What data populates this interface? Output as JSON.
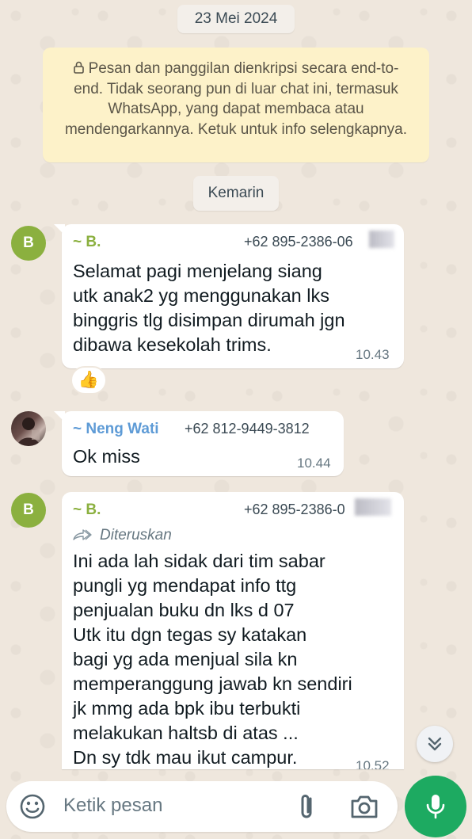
{
  "date_chip": "23 Mei 2024",
  "encryption_notice": "Pesan dan panggilan dienkripsi secara end-to-end. Tidak seorang pun di luar chat ini, termasuk WhatsApp, yang dapat membaca atau mendengarkannya. Ketuk untuk info selengkapnya.",
  "day_chip": "Kemarin",
  "messages": [
    {
      "avatar_initial": "B",
      "sender": "~ B.",
      "phone": "+62 895-2386-06",
      "text": "Selamat pagi menjelang siang\nutk anak2 yg menggunakan lks\nbinggris tlg disimpan dirumah jgn\ndibawa kesekolah trims.",
      "time": "10.43",
      "reaction": "👍"
    },
    {
      "sender": "~ Neng Wati",
      "phone": "+62 812-9449-3812",
      "text": "Ok miss",
      "time": "10.44"
    },
    {
      "avatar_initial": "B",
      "sender": "~ B.",
      "phone": "+62 895-2386-0",
      "forwarded_label": "Diteruskan",
      "text": "Ini ada lah sidak dari tim sabar\npungli yg mendapat info ttg\npenjualan buku dn lks d 07\nUtk itu dgn tegas sy katakan\nbagi yg ada menjual sila kn\nmemperanggung jawab kn sendiri\njk mmg ada bpk ibu terbukti\nmelakukan haltsb di atas ...\nDn sy tdk mau ikut campur.",
      "time": "10.52"
    }
  ],
  "input": {
    "placeholder": "Ketik pesan"
  },
  "colors": {
    "wallpaper": "#efe7dd",
    "sender_b": "#8bb03f",
    "sender_neng": "#5e9bd6",
    "mic_button": "#1daa61"
  }
}
